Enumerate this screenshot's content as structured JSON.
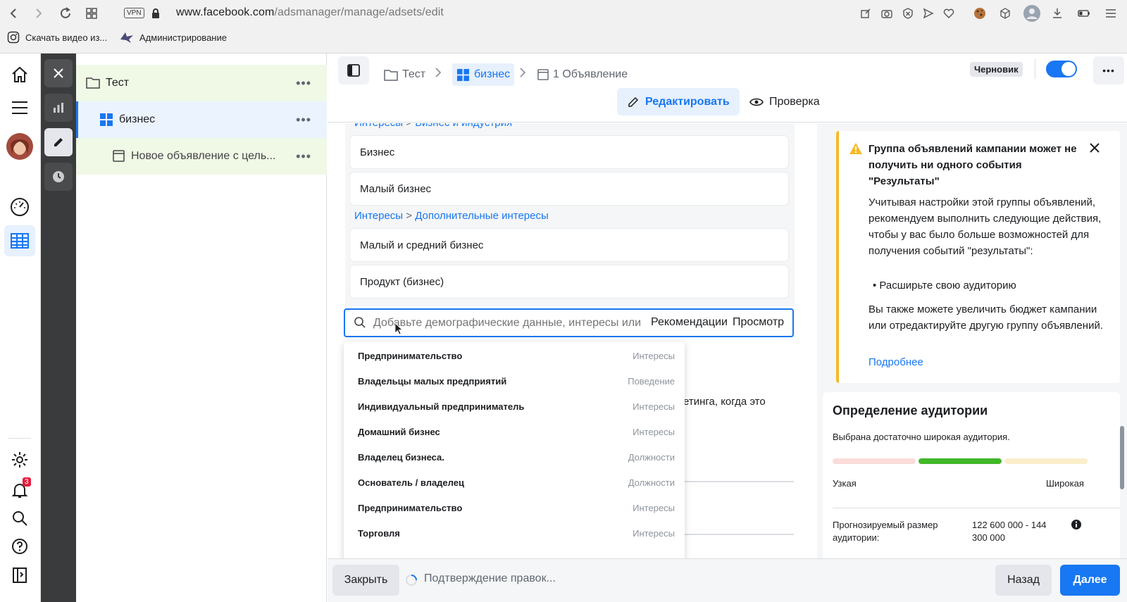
{
  "browser": {
    "vpn_label": "VPN",
    "url_host": "www.facebook.com",
    "url_path": "/adsmanager/manage/adsets/edit",
    "bookmarks": [
      "Скачать видео из...",
      "Администрирование"
    ]
  },
  "left_nav": {
    "notification_count": "3"
  },
  "tree": {
    "campaign": "Тест",
    "adset": "бизнес",
    "ad": "Новое объявление с цель...",
    "more": "•••"
  },
  "header": {
    "breadcrumb": [
      "Тест",
      "бизнес",
      "1 Объявление"
    ],
    "status_badge": "Черновик",
    "more": "•••",
    "tab_edit": "Редактировать",
    "tab_review": "Проверка"
  },
  "targeting": {
    "group1_path_a": "Интересы",
    "group1_path_sep": ">",
    "group1_path_b": "Бизнес и индустрия",
    "group1_items": [
      "Бизнес",
      "Малый бизнес"
    ],
    "group2_path_a": "Интересы",
    "group2_path_sep": ">",
    "group2_path_b": "Дополнительные интересы",
    "group2_items": [
      "Малый и средний бизнес",
      "Продукт (бизнес)"
    ],
    "search_placeholder": "Добавьте демографические данные, интересы или м",
    "recommendations": "Рекомендации",
    "browse": "Просмотр",
    "partial_text": "етинга, когда это"
  },
  "suggestions": [
    {
      "name": "Предпринимательство",
      "category": "Интересы"
    },
    {
      "name": "Владельцы малых предприятий",
      "category": "Поведение"
    },
    {
      "name": "Индивидуальный предприниматель",
      "category": "Интересы"
    },
    {
      "name": "Домашний бизнес",
      "category": "Интересы"
    },
    {
      "name": "Владелец бизнеса.",
      "category": "Должности"
    },
    {
      "name": "Основатель / владелец",
      "category": "Должности"
    },
    {
      "name": "Предпринимательство",
      "category": "Интересы"
    },
    {
      "name": "Торговля",
      "category": "Интересы"
    }
  ],
  "warning": {
    "title": "Группа объявлений кампании может не получить ни одного события \"Результаты\"",
    "body": "Учитывая настройки этой группы объявлений, рекомендуем выполнить следующие действия, чтобы у вас было больше возможностей для получения событий \"результаты\":",
    "bullet": "Расширьте свою аудиторию",
    "body2": "Вы также можете увеличить бюджет кампании или отредактируйте другую группу объявлений.",
    "link": "Подробнее"
  },
  "audience": {
    "title": "Определение аудитории",
    "subtitle": "Выбрана достаточно широкая аудитория.",
    "narrow": "Узкая",
    "broad": "Широкая",
    "size_label": "Прогнозируемый размер аудитории:",
    "size_value": "122 600 000 - 144 300 000",
    "level": "broad"
  },
  "footer": {
    "close": "Закрыть",
    "status": "Подтверждение правок...",
    "back": "Назад",
    "next": "Далее"
  },
  "colors": {
    "accent": "#1877f2",
    "warning": "#f7b928",
    "meter_green": "#42b72a"
  }
}
